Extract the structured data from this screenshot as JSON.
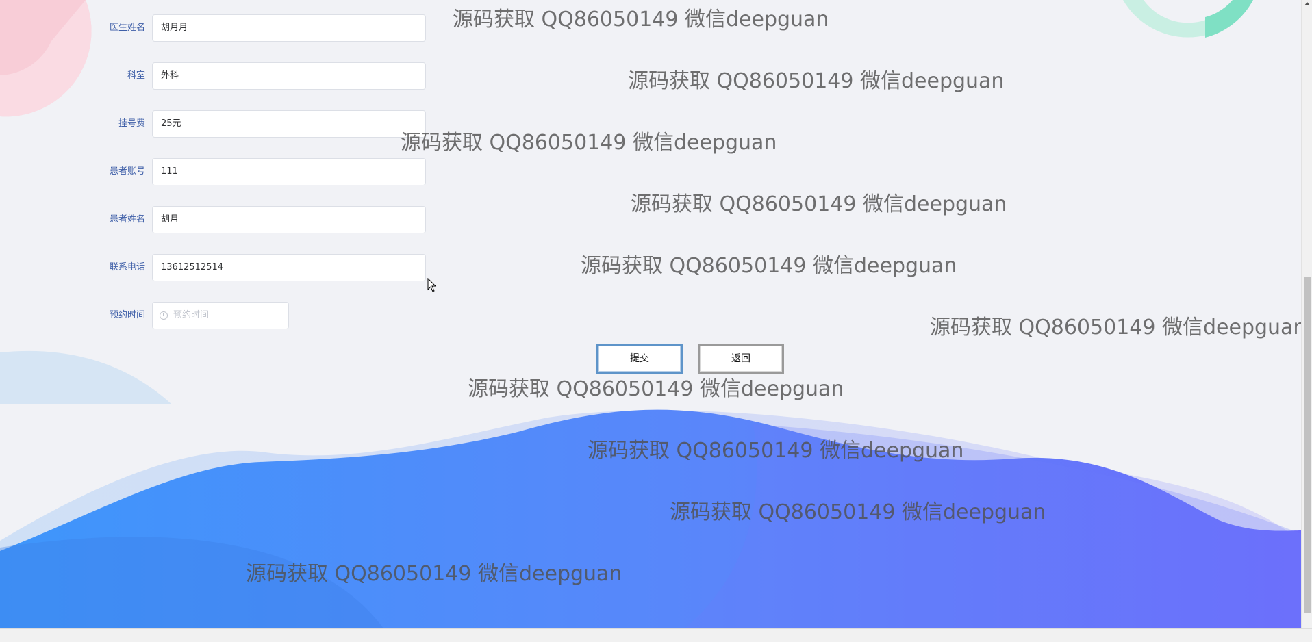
{
  "form": {
    "fields": [
      {
        "label": "医生姓名",
        "value": "胡月月"
      },
      {
        "label": "科室",
        "value": "外科"
      },
      {
        "label": "挂号费",
        "value": "25元"
      },
      {
        "label": "患者账号",
        "value": "111"
      },
      {
        "label": "患者姓名",
        "value": "胡月"
      },
      {
        "label": "联系电话",
        "value": "13612512514"
      }
    ],
    "appointment": {
      "label": "预约时间",
      "placeholder": "预约时间"
    },
    "submit_label": "提交",
    "back_label": "返回"
  },
  "watermark_text": "源码获取 QQ86050149 微信deepguan",
  "colors": {
    "label": "#3e5fa8",
    "background": "#f1f2f6",
    "wave_start": "#3e96fb",
    "wave_end": "#6f6ffb",
    "submit_border": "#5e94c9"
  }
}
